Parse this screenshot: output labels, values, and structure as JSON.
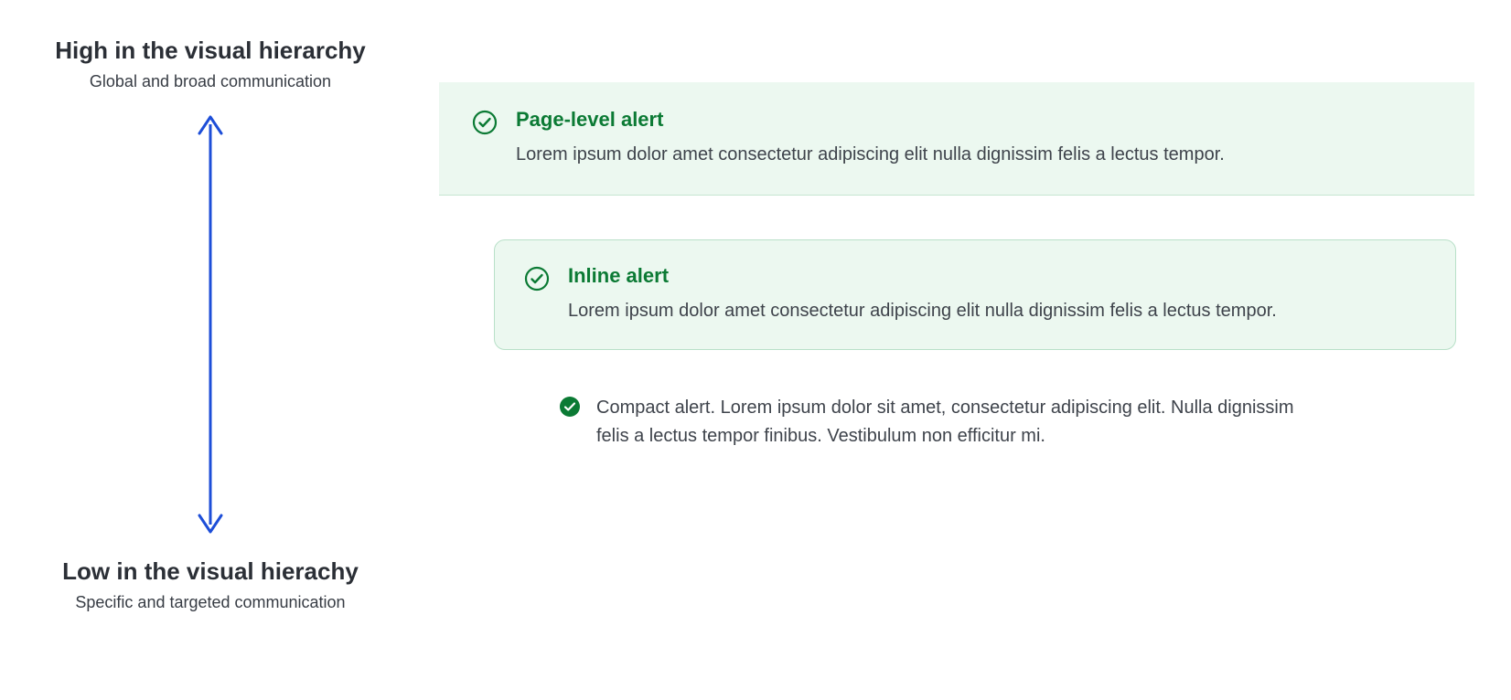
{
  "hierarchy": {
    "high": {
      "title": "High in the visual hierarchy",
      "subtitle": "Global and broad communication"
    },
    "low": {
      "title": "Low in the visual hierachy",
      "subtitle": "Specific and targeted communication"
    }
  },
  "alerts": {
    "page": {
      "title": "Page-level alert",
      "body": "Lorem ipsum dolor amet consectetur adipiscing elit nulla dignissim felis a lectus tempor."
    },
    "inline": {
      "title": "Inline alert",
      "body": "Lorem ipsum dolor amet consectetur adipiscing elit nulla dignissim felis a lectus tempor."
    },
    "compact": {
      "body": "Compact alert. Lorem ipsum dolor sit amet, consectetur adipiscing elit. Nulla dignissim felis a lectus tempor finibus. Vestibulum non efficitur mi."
    }
  },
  "colors": {
    "arrow": "#1d4ed8",
    "success": "#0b7a34",
    "successBg": "#ecf8f0",
    "successBorder": "#b8e0c8",
    "text": "#3e434b",
    "heading": "#2b2f36"
  }
}
